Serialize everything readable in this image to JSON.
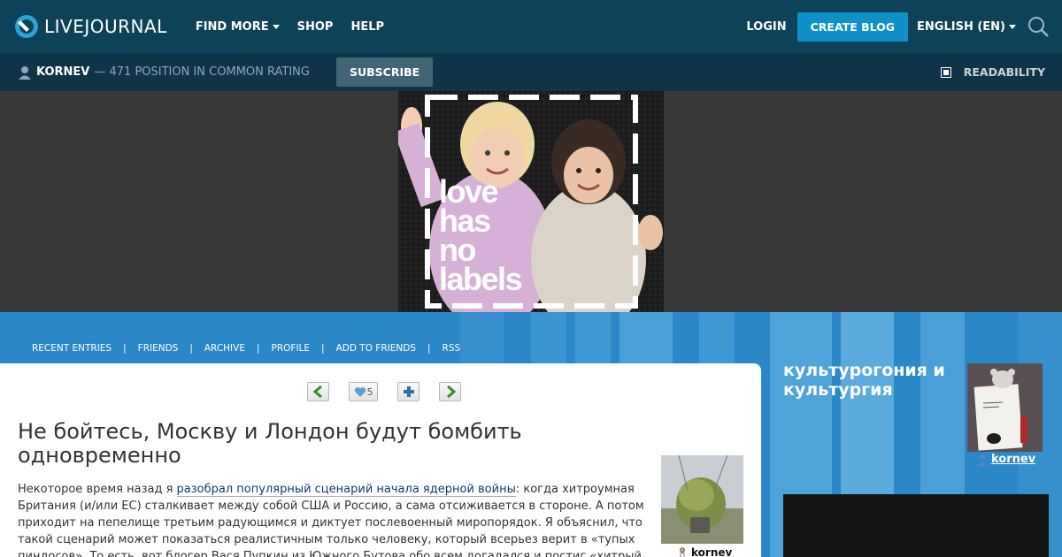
{
  "topbar": {
    "logo_text": "LIVEJOURNAL",
    "nav": [
      "FIND MORE",
      "SHOP",
      "HELP"
    ],
    "login": "LOGIN",
    "create_blog": "CREATE BLOG",
    "language": "ENGLISH (EN)"
  },
  "journalbar": {
    "username": "KORNEV",
    "rating": "— 471 POSITION IN COMMON RATING",
    "subscribe": "SUBSCRIBE",
    "readability": "READABILITY"
  },
  "ad": {
    "text_lines": [
      "love",
      "has",
      "no",
      "labels"
    ]
  },
  "journal_nav": [
    "RECENT ENTRIES",
    "FRIENDS",
    "ARCHIVE",
    "PROFILE",
    "ADD TO FRIENDS",
    "RSS"
  ],
  "entry": {
    "like_count": "5",
    "title": "Не бойтесь, Москву и Лондон будут бомбить одновременно",
    "body_prefix": "Некоторое время назад я ",
    "body_link": "разобрал популярный сценарий начала ядерной войны",
    "body_rest": ": когда хитроумная Британия (и/или ЕС) сталкивает между собой США и Россию, а сама отсиживается в стороне. А потом приходит на пепелище третьим радующимся и диктует послевоенный миропорядок. Я объяснил, что такой сценарий может показаться реалистичным только человеку, который всерьез верит в «тупых пиндосов». То есть, вот блогер Вася Пупкин из Южного Бутова обо всем догадался и постиг «хитрый",
    "author": "kornev"
  },
  "sidebar": {
    "title": "культурогония и культургия",
    "username": "kornev"
  },
  "colors": {
    "topbar_bg": "#0d4258",
    "journalbar_bg": "#0f3448",
    "accent_button": "#0f91c8",
    "header_blue": "#2b88c8"
  }
}
